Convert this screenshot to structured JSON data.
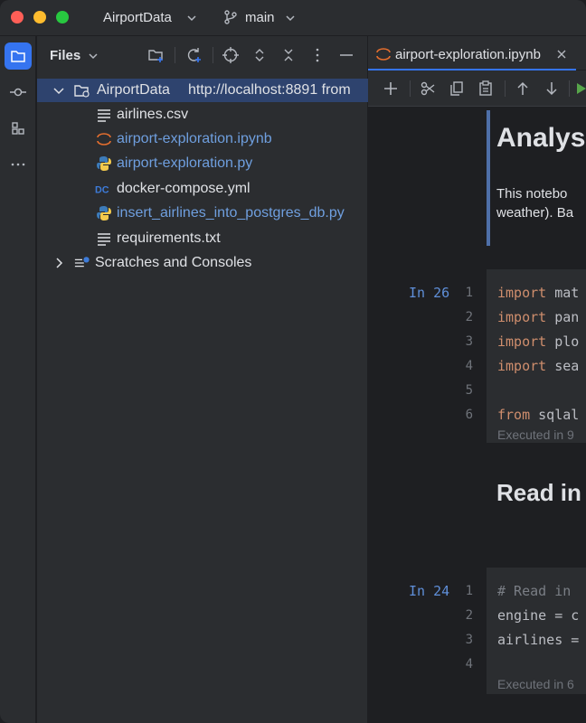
{
  "window": {
    "project_name": "AirportData",
    "branch": "main"
  },
  "project_panel": {
    "title": "Files",
    "root": {
      "name": "AirportData",
      "url": "http://localhost:8891 from"
    },
    "files": [
      {
        "name": "airlines.csv",
        "icon": "text-file-icon",
        "state": "default"
      },
      {
        "name": "airport-exploration.ipynb",
        "icon": "jupyter-icon",
        "state": "vcs"
      },
      {
        "name": "airport-exploration.py",
        "icon": "python-icon",
        "state": "vcs"
      },
      {
        "name": "docker-compose.yml",
        "icon": "docker-compose-icon",
        "state": "default"
      },
      {
        "name": "insert_airlines_into_postgres_db.py",
        "icon": "python-icon",
        "state": "vcs"
      },
      {
        "name": "requirements.txt",
        "icon": "text-file-icon",
        "state": "default"
      }
    ],
    "scratches": "Scratches and Consoles"
  },
  "editor": {
    "tab_label": "airport-exploration.ipynb",
    "markdown_heading": "Analys",
    "markdown_line1": "This notebo",
    "markdown_line2": "weather). Ba",
    "cell1": {
      "label": "In 26",
      "lines": [
        {
          "n": "1",
          "kw": "import",
          "rest": " mat"
        },
        {
          "n": "2",
          "kw": "import",
          "rest": " pan"
        },
        {
          "n": "3",
          "kw": "import",
          "rest": " plo"
        },
        {
          "n": "4",
          "kw": "import",
          "rest": " sea"
        },
        {
          "n": "5",
          "kw": "",
          "rest": ""
        },
        {
          "n": "6",
          "kw": "from",
          "rest": " sqlal"
        }
      ],
      "exec": "Executed in 9"
    },
    "heading2": "Read in",
    "cell2": {
      "label": "In 24",
      "lines": [
        {
          "n": "1",
          "text": "# Read in",
          "type": "comment"
        },
        {
          "n": "2",
          "text": "engine = c",
          "type": "code"
        },
        {
          "n": "3",
          "text": "airlines =",
          "type": "code"
        },
        {
          "n": "4",
          "text": "",
          "type": "code"
        }
      ],
      "exec": "Executed in 6"
    }
  },
  "colors": {
    "accent": "#3574f0",
    "vcs_modified": "#6f9fdf",
    "keyword": "#cf8e6d"
  }
}
